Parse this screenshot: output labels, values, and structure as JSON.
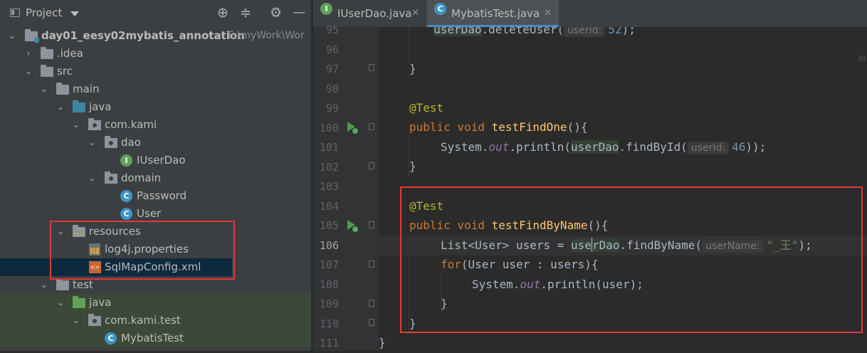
{
  "project_panel": {
    "title": "Project",
    "tools": [
      "locate-icon",
      "collapse-icon",
      "settings-icon",
      "hide-icon"
    ],
    "tree": [
      {
        "label": "day01_eesy02mybatis_annotation",
        "path": "E:\\myWork\\Wor",
        "type": "module",
        "expanded": true
      },
      {
        "label": ".idea",
        "type": "folder",
        "expanded": false
      },
      {
        "label": "src",
        "type": "folder",
        "expanded": true
      },
      {
        "label": "main",
        "type": "folder",
        "expanded": true
      },
      {
        "label": "java",
        "type": "source-folder",
        "expanded": true
      },
      {
        "label": "com.kami",
        "type": "package",
        "expanded": true
      },
      {
        "label": "dao",
        "type": "package",
        "expanded": true
      },
      {
        "label": "IUserDao",
        "type": "interface"
      },
      {
        "label": "domain",
        "type": "package",
        "expanded": true
      },
      {
        "label": "Password",
        "type": "class"
      },
      {
        "label": "User",
        "type": "class"
      },
      {
        "label": "resources",
        "type": "resources-folder",
        "expanded": true
      },
      {
        "label": "log4j.properties",
        "type": "properties"
      },
      {
        "label": "SqlMapConfig.xml",
        "type": "xml"
      },
      {
        "label": "test",
        "type": "folder",
        "expanded": true
      },
      {
        "label": "java",
        "type": "test-folder",
        "expanded": true
      },
      {
        "label": "com.kami.test",
        "type": "package",
        "expanded": true
      },
      {
        "label": "MybatisTest",
        "type": "class"
      }
    ]
  },
  "editor": {
    "tabs": [
      {
        "label": "IUserDao.java",
        "icon": "interface-icon",
        "active": false
      },
      {
        "label": "MybatisTest.java",
        "icon": "class-icon",
        "active": true
      }
    ],
    "lines": [
      {
        "n": "95"
      },
      {
        "n": "96"
      },
      {
        "n": "97"
      },
      {
        "n": "98"
      },
      {
        "n": "99"
      },
      {
        "n": "100"
      },
      {
        "n": "101"
      },
      {
        "n": "102"
      },
      {
        "n": "103"
      },
      {
        "n": "104"
      },
      {
        "n": "105"
      },
      {
        "n": "106"
      },
      {
        "n": "107"
      },
      {
        "n": "108"
      },
      {
        "n": "109"
      },
      {
        "n": "110"
      },
      {
        "n": "111"
      }
    ],
    "code": {
      "l95": {
        "pre": "    ",
        "var": "userDao",
        "call": ".deleteUser(",
        "hint": "userId:",
        "num": "52",
        "post": ");"
      },
      "l97": "}",
      "l99": "@Test",
      "l100": {
        "kw": "public void ",
        "fn": "testFindOne",
        "rest": "(){"
      },
      "l101": {
        "a": "System.",
        "fld": "out",
        "b": ".println(",
        "var": "userDao",
        "c": ".findById(",
        "hint": "userId:",
        "num": "46",
        "d": "));"
      },
      "l102": "}",
      "l104": "@Test",
      "l105": {
        "kw": "public void ",
        "fn": "testFindByName",
        "rest": "(){"
      },
      "l106": {
        "a": "List<User> users = ",
        "var1": "use",
        "var2": "rDao",
        "b": ".findByName(",
        "hint": "userName:",
        "str": "\"_王\"",
        "c": ");"
      },
      "l107": {
        "kw": "for",
        "rest": "(User user : users){"
      },
      "l108": {
        "a": "System.",
        "fld": "out",
        "b": ".println(user);"
      },
      "l109": "}",
      "l110": "}",
      "l111": "}"
    }
  }
}
